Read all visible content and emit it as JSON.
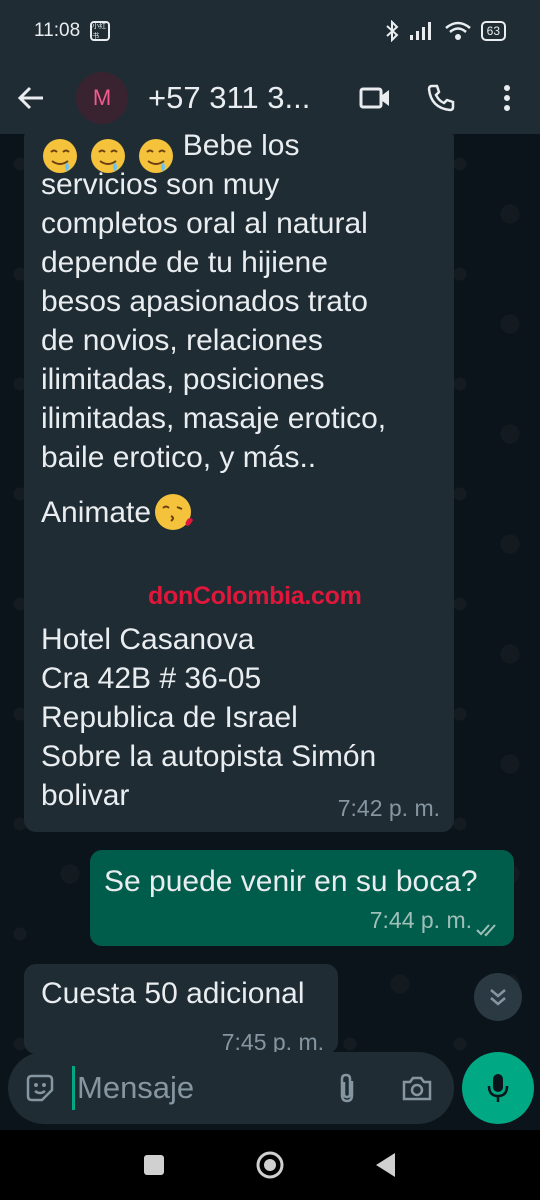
{
  "status": {
    "time": "11:08",
    "notif": "小红书",
    "battery": "63"
  },
  "header": {
    "avatar_letter": "M",
    "contact": "+57 311 3..."
  },
  "messages": {
    "m1": {
      "body": "                 Bebe los\nservicios son muy\ncompletos oral al natural\ndepende de tu hijiene\nbesos apasionados trato\nde novios, relaciones\nilimitadas, posiciones\nilimitadas, masaje erotico,\nbaile erotico, y más..",
      "animate": "Animate",
      "address": "Hotel Casanova\nCra 42B # 36-05\nRepublica de Israel\nSobre la autopista Simón\nbolivar",
      "time": "7:42 p. m."
    },
    "m2": {
      "body": "Se puede venir en su boca?",
      "time": "7:44 p. m."
    },
    "m3": {
      "body": "Cuesta 50 adicional",
      "time": "7:45 p. m."
    }
  },
  "watermark": "donColombia.com",
  "input": {
    "placeholder": "Mensaje"
  },
  "colors": {
    "header": "#1f2c34",
    "incoming": "#1f2c34",
    "outgoing": "#005c4b",
    "accent": "#00a884"
  }
}
